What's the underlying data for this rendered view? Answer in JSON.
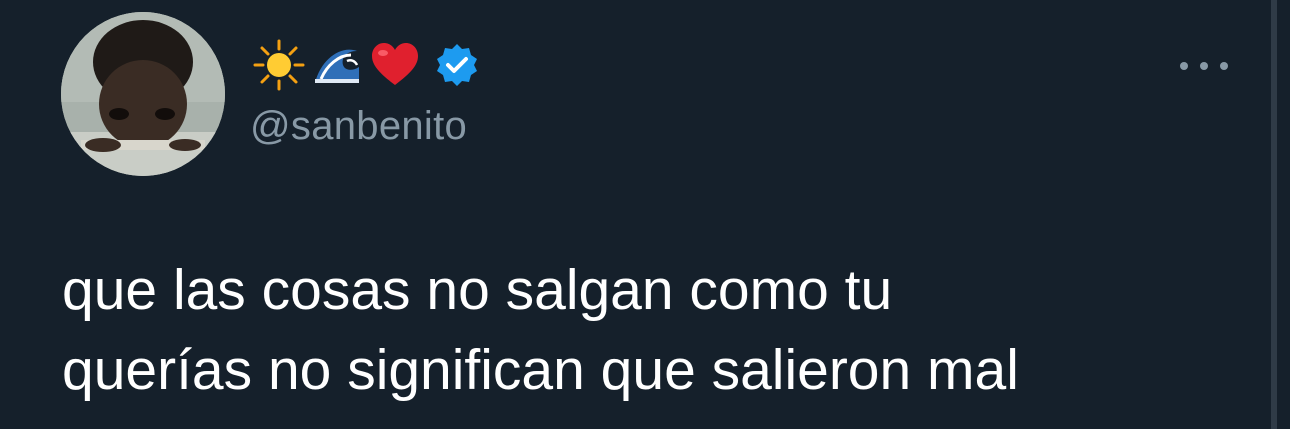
{
  "tweet": {
    "display_name_emojis": [
      "sun-emoji",
      "wave-emoji",
      "heart-emoji"
    ],
    "verified": true,
    "handle": "@sanbenito",
    "text_lines": [
      "que las cosas no salgan como tu",
      "querías no significan que salieron mal"
    ]
  },
  "colors": {
    "background": "#15202b",
    "text": "#ffffff",
    "secondary_text": "#8899a6",
    "verified_blue": "#1d9bf0"
  },
  "icons": {
    "more_menu": "more-horizontal-icon",
    "verified": "verified-badge-icon"
  }
}
